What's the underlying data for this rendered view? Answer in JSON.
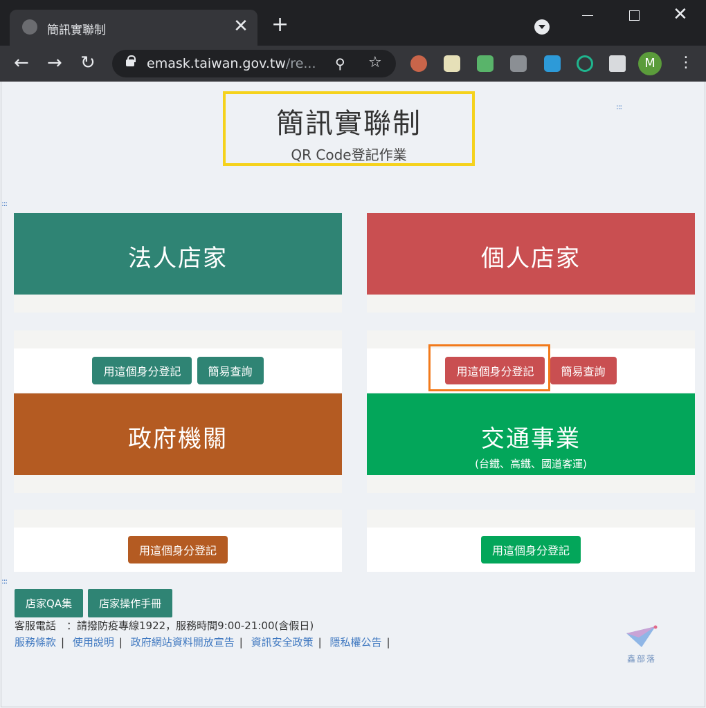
{
  "browser": {
    "tab_title": "簡訊實聯制",
    "tab_close": "✕",
    "new_tab": "+",
    "back": "←",
    "forward": "→",
    "reload": "↻",
    "url_main": "emask.taiwan.gov.tw",
    "url_dim": "/re...",
    "avatar_letter": "M",
    "menu": "⋮"
  },
  "header": {
    "title": "簡訊實聯制",
    "subtitle": "QR Code登記作業"
  },
  "cards": [
    {
      "name": "法人店家",
      "color": "#2f8474",
      "buttons": [
        "用這個身分登記",
        "簡易查詢"
      ]
    },
    {
      "name": "個人店家",
      "color": "#c94f51",
      "buttons": [
        "用這個身分登記",
        "簡易查詢"
      ]
    },
    {
      "name": "政府機關",
      "color": "#b45b22",
      "buttons": [
        "用這個身分登記"
      ]
    },
    {
      "name": "交通事業",
      "note": "(台鐵、高鐵、國道客運)",
      "color": "#03a65a",
      "buttons": [
        "用這個身分登記"
      ]
    }
  ],
  "footer": {
    "buttons": [
      "店家QA集",
      "店家操作手冊"
    ],
    "contact": "客服電話　：請撥防疫專線1922，服務時間9:00-21:00(含假日)",
    "links": [
      "服務條款",
      "使用說明",
      "政府網站資料開放宣告",
      "資訊安全政策",
      "隱私權公告"
    ],
    "link_separator": "|",
    "watermark": "鑫部落"
  }
}
